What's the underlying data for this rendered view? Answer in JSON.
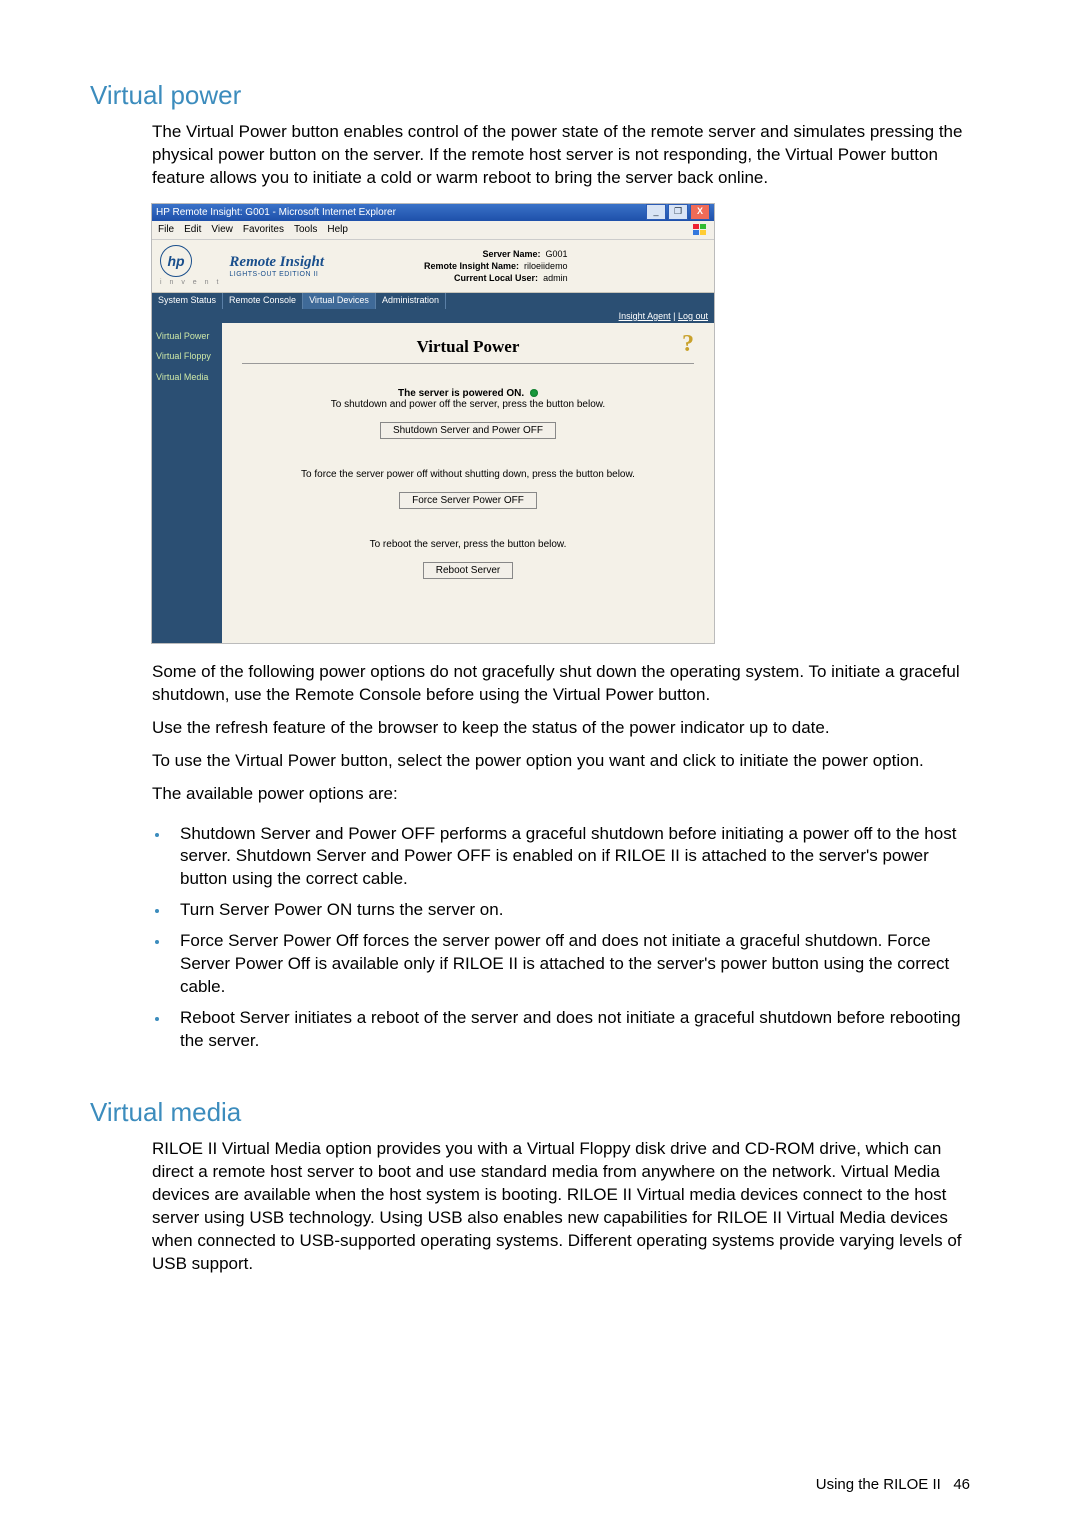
{
  "sections": {
    "virtual_power": {
      "heading": "Virtual power",
      "intro": "The Virtual Power button enables control of the power state of the remote server and simulates pressing the physical power button on the server. If the remote host server is not responding, the Virtual Power button feature allows you to initiate a cold or warm reboot to bring the server back online.",
      "after1": "Some of the following power options do not gracefully shut down the operating system. To initiate a graceful shutdown, use the Remote Console before using the Virtual Power button.",
      "after2": "Use the refresh feature of the browser to keep the status of the power indicator up to date.",
      "after3": "To use the Virtual Power button, select the power option you want and click to initiate the power option.",
      "after4": "The available power options are:",
      "bullets": [
        "Shutdown Server and Power OFF performs a graceful shutdown before initiating a power off to the host server. Shutdown Server and Power OFF is enabled on if RILOE II is attached to the server's power button using the correct cable.",
        "Turn Server Power ON turns the server on.",
        "Force Server Power Off forces the server power off and does not initiate a graceful shutdown. Force Server Power Off is available only if RILOE II is attached to the server's power button using the correct cable.",
        "Reboot Server initiates a reboot of the server and does not initiate a graceful shutdown before rebooting the server."
      ]
    },
    "virtual_media": {
      "heading": "Virtual media",
      "body": "RILOE II Virtual Media option provides you with a Virtual Floppy disk drive and CD-ROM drive, which can direct a remote host server to boot and use standard media from anywhere on the network. Virtual Media devices are available when the host system is booting. RILOE II Virtual media devices connect to the host server using USB technology. Using USB also enables new capabilities for RILOE II Virtual Media devices when connected to USB-supported operating systems. Different operating systems provide varying levels of USB support."
    }
  },
  "screenshot": {
    "titlebar": "HP Remote Insight: G001 - Microsoft Internet Explorer",
    "menus": [
      "File",
      "Edit",
      "View",
      "Favorites",
      "Tools",
      "Help"
    ],
    "brand": {
      "logo": "hp",
      "invent": "i n v e n t",
      "product": "Remote Insight",
      "edition": "LIGHTS-OUT EDITION II"
    },
    "server_info": {
      "l1_label": "Server Name:",
      "l1_val": "G001",
      "l2_label": "Remote Insight Name:",
      "l2_val": "riloeiidemo",
      "l3_label": "Current Local User:",
      "l3_val": "admin"
    },
    "tabs": [
      "System Status",
      "Remote Console",
      "Virtual Devices",
      "Administration"
    ],
    "active_tab_index": 2,
    "links": {
      "agent": "Insight Agent",
      "logout": "Log out"
    },
    "sidebar": [
      "Virtual Power",
      "Virtual Floppy",
      "Virtual Media"
    ],
    "panel": {
      "title": "Virtual Power",
      "status_bold": "The server is powered ON.",
      "status_sub": "To shutdown and power off the server, press the button below.",
      "btn1": "Shutdown Server and Power OFF",
      "force_text": "To force the server power off without shutting down, press the button below.",
      "btn2": "Force Server Power OFF",
      "reboot_text": "To reboot the server, press the button below.",
      "btn3": "Reboot Server"
    }
  },
  "footer": {
    "text": "Using the RILOE II",
    "page": "46"
  }
}
